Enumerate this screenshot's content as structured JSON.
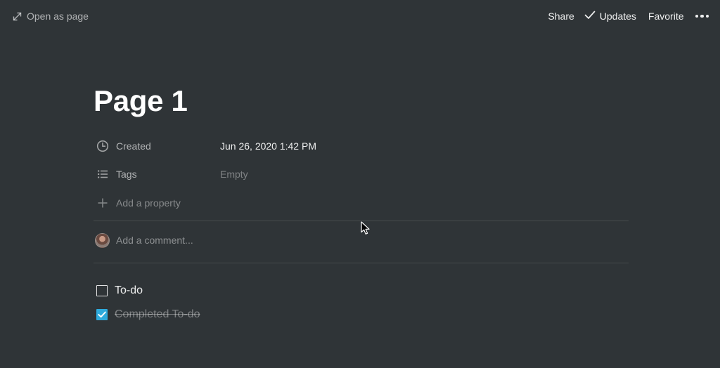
{
  "topbar": {
    "open_as_page": "Open as page",
    "share": "Share",
    "updates": "Updates",
    "favorite": "Favorite"
  },
  "page": {
    "title": "Page 1"
  },
  "properties": [
    {
      "icon": "clock-icon",
      "name": "Created",
      "value": "Jun 26, 2020 1:42 PM"
    },
    {
      "icon": "list-icon",
      "name": "Tags",
      "value": "Empty"
    }
  ],
  "add_property": "Add a property",
  "comment": {
    "placeholder": "Add a comment..."
  },
  "todos": [
    {
      "text": "To-do",
      "checked": false
    },
    {
      "text": "Completed To-do",
      "checked": true
    }
  ],
  "colors": {
    "background": "#2f3437",
    "checkbox_accent": "#2eaadc"
  }
}
